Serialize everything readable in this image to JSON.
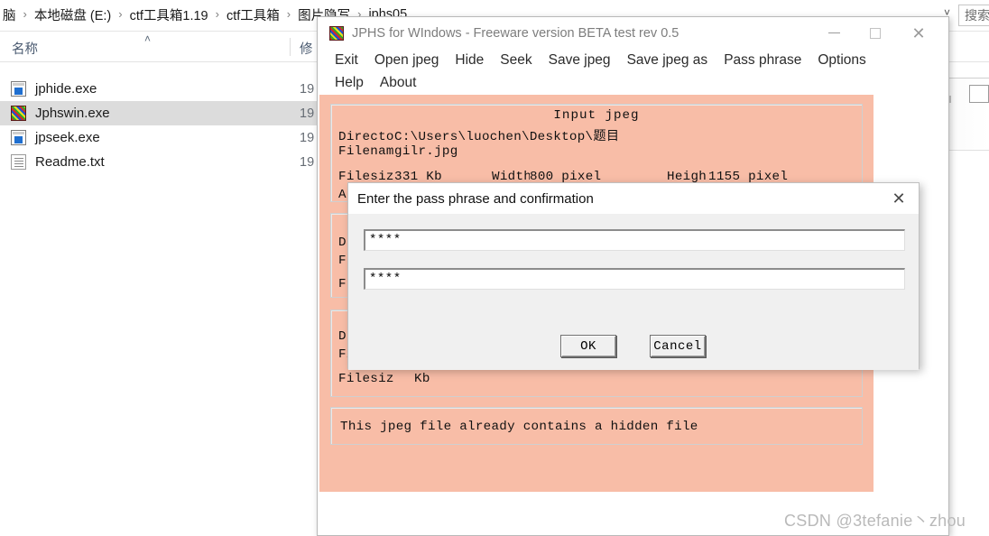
{
  "explorer": {
    "breadcrumb": {
      "name": "address-breadcrumb",
      "items": [
        "脑",
        "本地磁盘 (E:)",
        "ctf工具箱1.19",
        "ctf工具箱",
        "图片隐写",
        "jphs05"
      ],
      "separator": "›",
      "chevron": "˅"
    },
    "search": {
      "placeholder": "搜索",
      "value": "搜索"
    },
    "columns": {
      "name": "名称",
      "sort_arrow": "˄",
      "modified": "修"
    },
    "files": [
      {
        "name": "jphide.exe",
        "icon": "exe-icon",
        "date": "19",
        "selected": false
      },
      {
        "name": "Jphswin.exe",
        "icon": "noise-icon",
        "date": "19",
        "selected": true
      },
      {
        "name": "jpseek.exe",
        "icon": "exe-icon",
        "date": "19",
        "selected": false
      },
      {
        "name": "Readme.txt",
        "icon": "text-icon",
        "date": "19",
        "selected": false
      }
    ]
  },
  "jphs_window": {
    "title": "JPHS for WIndows - Freeware version BETA test rev 0.5",
    "app_icon": "jphs-noise-icon",
    "window_controls": {
      "minimize": "—",
      "maximize": "□",
      "close": "✕"
    },
    "menu_row_1": [
      "Exit",
      "Open jpeg",
      "Hide",
      "Seek",
      "Save jpeg",
      "Save jpeg as",
      "Pass phrase",
      "Options"
    ],
    "menu_row_2": [
      "Help",
      "About"
    ],
    "body_color": "#f8bda7",
    "panels": {
      "input": {
        "title": "Input jpeg",
        "directory_label": "Director",
        "directory_value": "C:\\Users\\luochen\\Desktop\\题目",
        "filename_label": "Filename",
        "filename_value": "gilr.jpg",
        "filesize_label": "Filesiz",
        "filesize_value": "331 Kb",
        "width_label": "Width",
        "width_value": "800 pixel",
        "height_label": "Heigh",
        "height_value": "1155 pixel",
        "approx_label": "A"
      },
      "hidden": {
        "directory_label": "D",
        "filename_label": "F",
        "filesize_label": "F"
      },
      "output": {
        "directory_label": "D",
        "filename_label": "Filename",
        "filename_value": "",
        "filesize_label": "Filesiz",
        "filesize_value": "Kb"
      },
      "status": {
        "message": "This jpeg file already contains a hidden file"
      }
    }
  },
  "pass_phrase_dialog": {
    "title": "Enter the pass phrase and confirmation",
    "close_glyph": "✕",
    "passphrase_value": "****",
    "confirmation_value": "****",
    "ok_label": "OK",
    "cancel_label": "Cancel"
  },
  "watermark": {
    "text": "CSDN @3tefanie丶zhou"
  }
}
